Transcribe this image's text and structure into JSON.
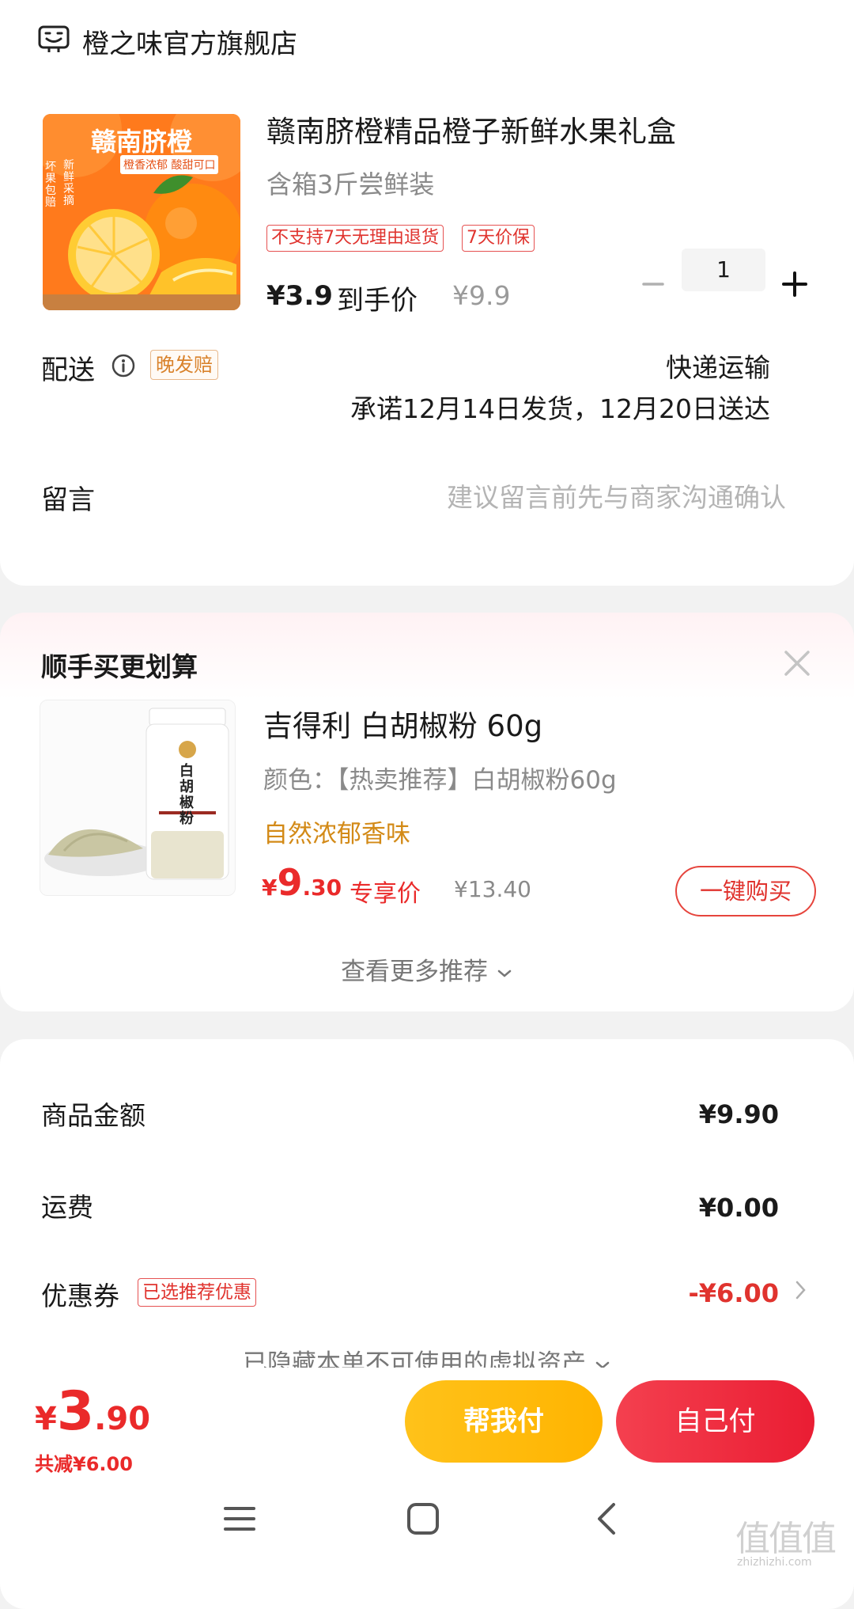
{
  "order": {
    "store_name": "橙之味官方旗舰店",
    "product": {
      "image_title": "赣南脐橙",
      "image_caption": "橙香浓郁 酸甜可口",
      "image_side_left": "坏果包赔",
      "image_side_right": "新鲜采摘",
      "title": "赣南脐橙精品橙子新鲜水果礼盒",
      "spec": "含箱3斤尝鲜装",
      "tags": [
        "不支持7天无理由退货",
        "7天价保"
      ],
      "price": "¥3.9",
      "price_label": "到手价",
      "original_price": "¥9.9",
      "quantity": "1"
    },
    "shipping": {
      "label": "配送",
      "badge": "晚发赔",
      "method": "快递运输",
      "promise": "承诺12月14日发货，12月20日送达"
    },
    "message": {
      "label": "留言",
      "placeholder": "建议留言前先与商家沟通确认"
    }
  },
  "recommend": {
    "title": "顺手买更划算",
    "item": {
      "image_text": "白胡椒粉",
      "title": "吉得利 白胡椒粉 60g",
      "spec": "颜色：【热卖推荐】白胡椒粉60g",
      "feature": "自然浓郁香味",
      "price_currency": "¥",
      "price_int": "9",
      "price_dec": ".30",
      "price_label": "专享价",
      "original_price": "¥13.40",
      "buy_label": "一键购买"
    },
    "more_label": "查看更多推荐"
  },
  "summary": {
    "goods_amount_label": "商品金额",
    "goods_amount": "¥9.90",
    "freight_label": "运费",
    "freight": "¥0.00",
    "coupon_label": "优惠券",
    "coupon_badge": "已选推荐优惠",
    "coupon_value": "-¥6.00",
    "hidden_assets_label": "已隐藏本单不可使用的虚拟资产"
  },
  "bottom": {
    "currency": "¥",
    "total_int": "3",
    "total_dec": ".90",
    "saved": "共减¥6.00",
    "help_pay_label": "帮我付",
    "self_pay_label": "自己付"
  },
  "watermark": {
    "text": "值值值",
    "sub": "zhizhizhi.com"
  },
  "colors": {
    "accent_red": "#ea2a2a",
    "accent_orange": "#d38a17",
    "help_pay_yellow": "#ffb400",
    "self_pay_red": "#ea1d33"
  }
}
